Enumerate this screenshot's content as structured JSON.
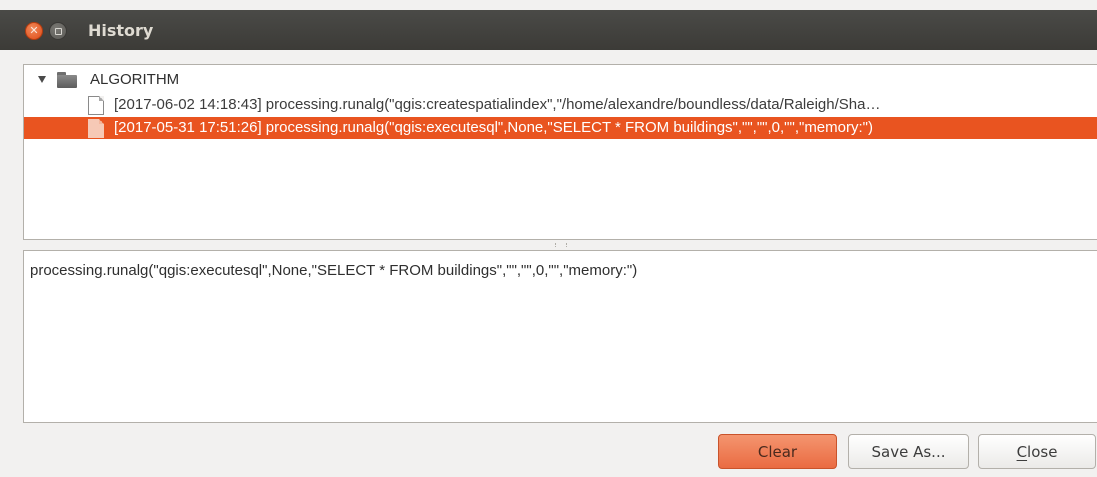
{
  "window": {
    "title": "History"
  },
  "tree": {
    "folder_label": "ALGORITHM",
    "items": [
      {
        "label": "[2017-06-02 14:18:43] processing.runalg(\"qgis:createspatialindex\",\"/home/alexandre/boundless/data/Raleigh/Sha…",
        "selected": false
      },
      {
        "label": "[2017-05-31 17:51:26] processing.runalg(\"qgis:executesql\",None,\"SELECT * FROM buildings\",\"\",\"\",0,\"\",\"memory:\")",
        "selected": true
      }
    ]
  },
  "detail": {
    "text": "processing.runalg(\"qgis:executesql\",None,\"SELECT * FROM buildings\",\"\",\"\",0,\"\",\"memory:\")"
  },
  "buttons": {
    "clear": "Clear",
    "save_as": "Save As...",
    "close": "Close"
  },
  "colors": {
    "selection": "#e95420",
    "titlebar": "#3c3b37",
    "background": "#f2f1f0"
  },
  "icons": {
    "close": "close-icon",
    "minimize": "minimize-icon",
    "expander": "expand-arrow-icon",
    "folder": "folder-icon",
    "file": "file-icon"
  }
}
